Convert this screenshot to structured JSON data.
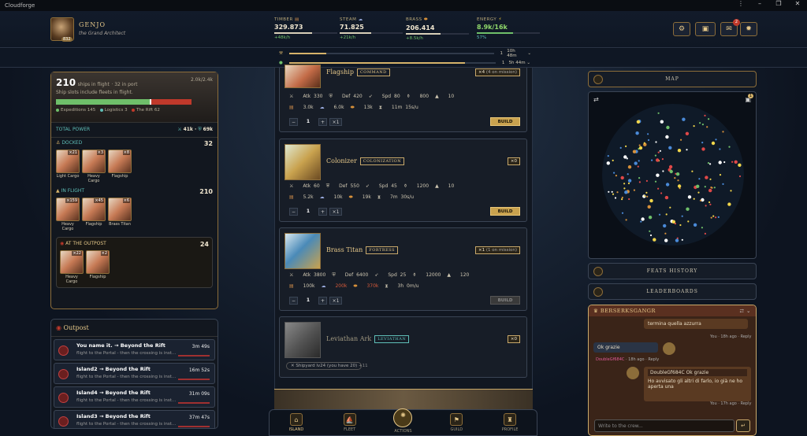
{
  "window": {
    "title": "Cloudforge"
  },
  "player": {
    "name": "GENJO",
    "title": "the Grand Architect",
    "level": "832"
  },
  "resources": [
    {
      "label": "TIMBER",
      "value": "329.873",
      "rate": "+48k/h",
      "fill": 0.6
    },
    {
      "label": "STEAM",
      "value": "71.825",
      "rate": "+21k/h",
      "fill": 0.5
    },
    {
      "label": "BRASS",
      "value": "206.414",
      "rate": "+8.5k/h",
      "fill": 0.55
    },
    {
      "label": "ENERGY",
      "value": "8.9k/16k",
      "rate": "57%",
      "fill": 0.57
    }
  ],
  "mail_badge": "2",
  "queue": [
    {
      "count": "1",
      "time": "10h 48m",
      "fill": 0.18
    },
    {
      "count": "1",
      "time": "5h 44m",
      "fill": 0.85
    }
  ],
  "fleet": {
    "ships_total": "210",
    "ships_label": "ships in flight",
    "in_port": "· 32 in port",
    "capacity": "2.0k/2.4k",
    "note": "Ship slots include fleets in flight.",
    "legend": [
      {
        "label": "Expeditions 145",
        "color": "#6fbf6a"
      },
      {
        "label": "Logistics 3",
        "color": "#5fbfb8"
      },
      {
        "label": "The Rift 62",
        "color": "#c0392b"
      }
    ],
    "total_power_label": "TOTAL POWER",
    "attack": "41k ·",
    "defense": "69k",
    "docked": {
      "label": "DOCKED",
      "count": "32",
      "ships": [
        {
          "name": "Light Cargo",
          "count": "×21"
        },
        {
          "name": "Heavy Cargo",
          "count": "×3"
        },
        {
          "name": "Flagship",
          "count": "×8"
        }
      ]
    },
    "in_flight": {
      "label": "IN FLIGHT",
      "count": "210",
      "ships": [
        {
          "name": "Heavy Cargo",
          "count": "×159"
        },
        {
          "name": "Flagship",
          "count": "×45"
        },
        {
          "name": "Brass Titan",
          "count": "×6"
        }
      ]
    },
    "outpost": {
      "label": "AT THE OUTPOST",
      "count": "24",
      "ships": [
        {
          "name": "Heavy Cargo",
          "count": "×22"
        },
        {
          "name": "Flagship",
          "count": "×2"
        }
      ]
    }
  },
  "outpost_panel": {
    "title": "Outpost",
    "trips": [
      {
        "title": "You name it. → Beyond the Rift",
        "sub": "flight to the Portal - then the crossing is inst...",
        "time": "3m 49s"
      },
      {
        "title": "Island2 → Beyond the Rift",
        "sub": "flight to the Portal - then the crossing is inst...",
        "time": "16m 52s"
      },
      {
        "title": "Island4 → Beyond the Rift",
        "sub": "flight to the Portal - then the crossing is inst...",
        "time": "31m 09s"
      },
      {
        "title": "Island3 → Beyond the Rift",
        "sub": "flight to the Portal - then the crossing is inst...",
        "time": "37m 47s"
      }
    ]
  },
  "ships": [
    {
      "name": "Flagship",
      "tag": "COMMAND",
      "count": "×4",
      "count_note": "(4 on mission)",
      "atk": "Atk 330",
      "def": "Def 420",
      "spd": "Spd 80",
      "cap": "800",
      "misc": "10",
      "c1": "3.0k",
      "c2": "6.0k",
      "c3": "13k",
      "time": "11m 15s/u",
      "qty": "1",
      "build": "BUILD"
    },
    {
      "name": "Colonizer",
      "tag": "COLONIZATION",
      "count": "×0",
      "count_note": "",
      "atk": "Atk 60",
      "def": "Def 550",
      "spd": "Spd 45",
      "cap": "1200",
      "misc": "10",
      "c1": "5.2k",
      "c2": "10k",
      "c3": "19k",
      "time": "7m 30s/u",
      "qty": "1",
      "build": "BUILD"
    },
    {
      "name": "Brass Titan",
      "tag": "FORTRESS",
      "count": "×1",
      "count_note": "(1 on mission)",
      "atk": "Atk 3800",
      "def": "Def 6400",
      "spd": "Spd 25",
      "cap": "12000",
      "misc": "120",
      "c1": "100k",
      "c2": "200k",
      "c3": "370k",
      "time": "3h 0m/u",
      "qty": "1",
      "build": "BUILD"
    },
    {
      "name": "Leviathan Ark",
      "tag": "LEVIATHAN",
      "count": "×0",
      "count_note": "",
      "req": "Shipyard lv24 (you have 20)",
      "req_more": "+11"
    }
  ],
  "nav": [
    {
      "label": "ISLAND"
    },
    {
      "label": "FLEET"
    },
    {
      "label": "ACTIONS"
    },
    {
      "label": "GUILD"
    },
    {
      "label": "PROFILE"
    }
  ],
  "right": {
    "map_label": "MAP",
    "map_badge": "1",
    "feats": "FEATS HISTORY",
    "leaderboards": "LEADERBOARDS"
  },
  "chat": {
    "guild": "BERSERKSGANGR",
    "m1": "termina quella azzurra",
    "m1meta": "You · 18h ago · Reply",
    "m2": "Ok grazie",
    "m2who": "DoubleGf684C",
    "m2meta": "· 18h ago · Reply",
    "m3quote": "DoubleGf684C Ok grazie",
    "m3": "Ho avvisato gli altri di farlo, io già ne ho aperta una",
    "m3meta": "You · 17h ago · Reply",
    "placeholder": "Write to the crew..."
  }
}
